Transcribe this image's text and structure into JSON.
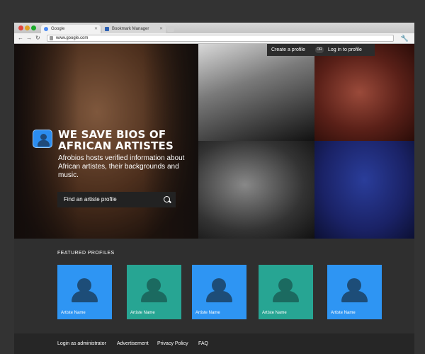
{
  "browser": {
    "tabs": [
      {
        "label": "Google",
        "active": true,
        "favicon_color": "#4a8af4"
      },
      {
        "label": "Bookmark Manager",
        "active": false,
        "favicon_color": "#2b5fb3"
      }
    ],
    "address": "www.google.com",
    "nav": {
      "back": "←",
      "forward": "→",
      "reload": "↻"
    },
    "menu_icon": "wrench-icon"
  },
  "header": {
    "create_profile": "Create a profile",
    "or": "OR",
    "login": "Log in to profile"
  },
  "hero": {
    "title": "WE SAVE BIOS OF AFRICAN ARTISTES",
    "subtitle": "Afrobios hosts verified information about African artistes, their backgrounds and music.",
    "search_placeholder": "Find an artiste profile"
  },
  "featured": {
    "title": "FEATURED PROFILES",
    "cards": [
      {
        "name": "Artiste Name",
        "color": "#2e95f3"
      },
      {
        "name": "Artiste Name",
        "color": "#27a593"
      },
      {
        "name": "Artiste Name",
        "color": "#2e95f3"
      },
      {
        "name": "Artiste Name",
        "color": "#27a593"
      },
      {
        "name": "Artiste Name",
        "color": "#2e95f3"
      }
    ]
  },
  "footer": {
    "links": [
      "Login as administrator",
      "Advertisement",
      "Privacy Policy",
      "FAQ"
    ]
  },
  "colors": {
    "page_bg": "#2f2f2f",
    "accent_blue": "#2e95f3",
    "accent_green": "#27a593"
  }
}
